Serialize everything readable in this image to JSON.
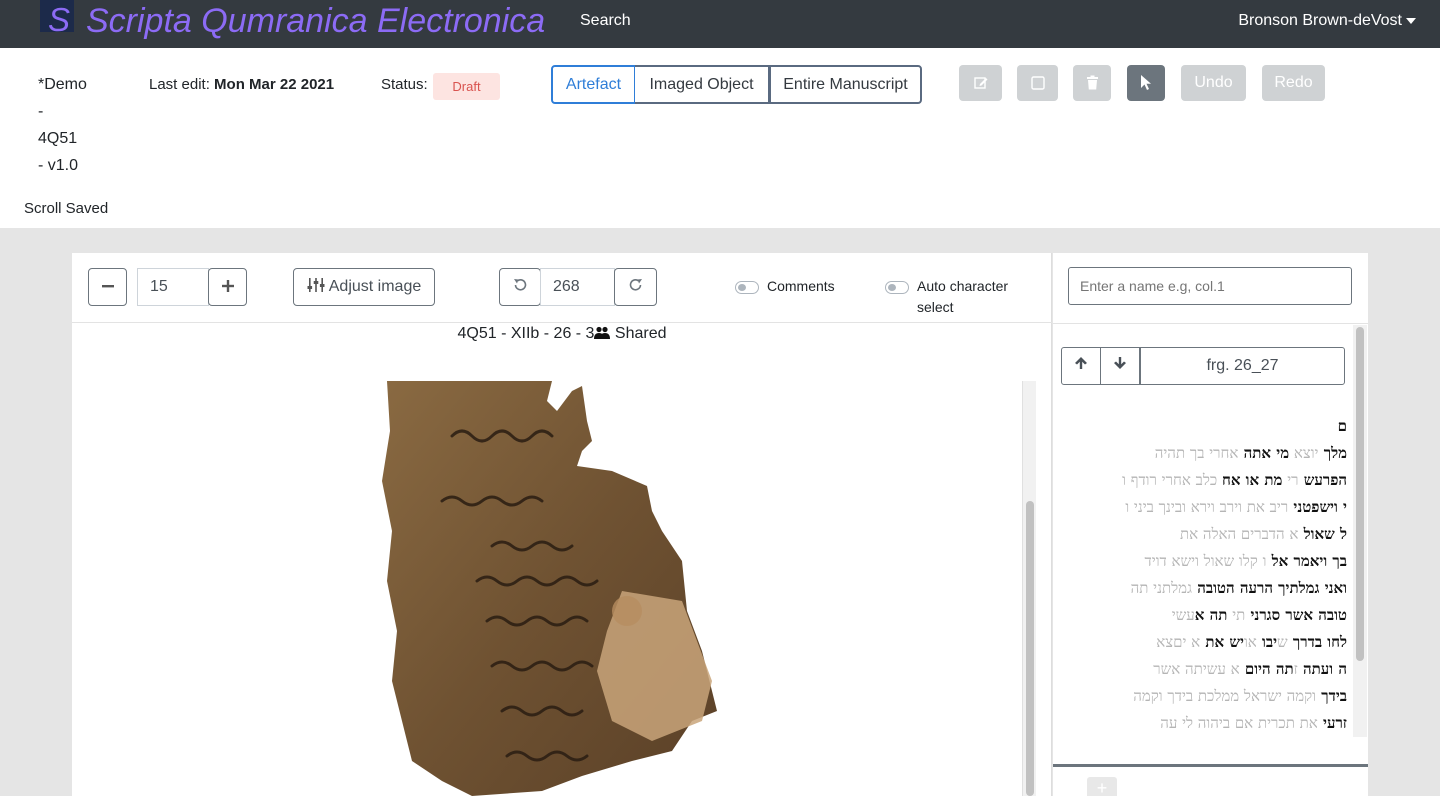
{
  "navbar": {
    "logo_letter": "S",
    "brand": "Scripta Qumranica Electronica",
    "search": "Search",
    "user": "Bronson Brown-deVost"
  },
  "header": {
    "title_lines": [
      "*Demo",
      "-",
      "4Q51",
      "- v1.0"
    ],
    "last_edit_label": "Last edit:",
    "last_edit_value": "Mon Mar 22 2021",
    "status_label": "Status:",
    "status_badge": "Draft",
    "view_tabs": [
      "Artefact",
      "Imaged Object",
      "Entire Manuscript"
    ],
    "active_tab": "Artefact",
    "undo": "Undo",
    "redo": "Redo",
    "scroll_saved": "Scroll Saved"
  },
  "toolbar": {
    "zoom_value": "15",
    "adjust_image": "Adjust image",
    "rotation_value": "268",
    "comments_label": "Comments",
    "auto_select_label_1": "Auto character",
    "auto_select_label_2": "select"
  },
  "caption": {
    "text": "4Q51 - XIIb - 26 - 3",
    "shared": "Shared"
  },
  "right_panel": {
    "name_placeholder": "Enter a name e.g, col.1",
    "fragment_label": "frg. 26_27",
    "text_lines": [
      [
        {
          "t": "ם",
          "k": 1
        }
      ],
      [
        {
          "t": "מלך ",
          "k": 1
        },
        {
          "t": "יוצא ",
          "k": 0
        },
        {
          "t": "מי אתה ",
          "k": 1
        },
        {
          "t": "אחרי בך תהיה",
          "k": 0
        }
      ],
      [
        {
          "t": "הפרעש ",
          "k": 1
        },
        {
          "t": "רי ",
          "k": 0
        },
        {
          "t": "מת או אח",
          "k": 1
        },
        {
          "t": " כלב אחרי רודף ו",
          "k": 0
        }
      ],
      [
        {
          "t": "י וישפטני ",
          "k": 1
        },
        {
          "t": "ריב את וירב וירא ובינך ביני ו",
          "k": 0
        }
      ],
      [
        {
          "t": "ל שאול ",
          "k": 1
        },
        {
          "t": "א הדברים האלה את ",
          "k": 0
        }
      ],
      [
        {
          "t": "בך ויאמר אל ",
          "k": 1
        },
        {
          "t": "ו קלו שאול וישא דויד",
          "k": 0
        }
      ],
      [
        {
          "t": "ואני גמלתיך הרעה ",
          "k": 1
        },
        {
          "t": "הטובה ",
          "k": 1
        },
        {
          "t": "גמלתני תה",
          "k": 0
        }
      ],
      [
        {
          "t": "טובה אשר סגרני ",
          "k": 1
        },
        {
          "t": "תי ",
          "k": 0
        },
        {
          "t": "תה א",
          "k": 1
        },
        {
          "t": "עשי",
          "k": 0
        }
      ],
      [
        {
          "t": "לחו בדרך ",
          "k": 1
        },
        {
          "t": "ש",
          "k": 0
        },
        {
          "t": "יבו ",
          "k": 1
        },
        {
          "t": "או",
          "k": 0
        },
        {
          "t": "יש את ",
          "k": 1
        },
        {
          "t": "א יםצא",
          "k": 0
        }
      ],
      [
        {
          "t": "ה ועתה ",
          "k": 1
        },
        {
          "t": "ז",
          "k": 0
        },
        {
          "t": "תה היום ",
          "k": 1
        },
        {
          "t": "א עשיתה אשר",
          "k": 0
        }
      ],
      [
        {
          "t": " בידך ",
          "k": 1
        },
        {
          "t": "וקמה ישראל ממלכת בידך וקמה",
          "k": 0
        }
      ],
      [
        {
          "t": "זרעי ",
          "k": 1
        },
        {
          "t": "את תכרית אם ביהוה לי עה",
          "k": 0
        }
      ]
    ]
  },
  "colors": {
    "navbar_bg": "#343a40",
    "brand": "#8c6bf5",
    "accent": "#2f7ed8",
    "draft_text": "#d9534f"
  }
}
